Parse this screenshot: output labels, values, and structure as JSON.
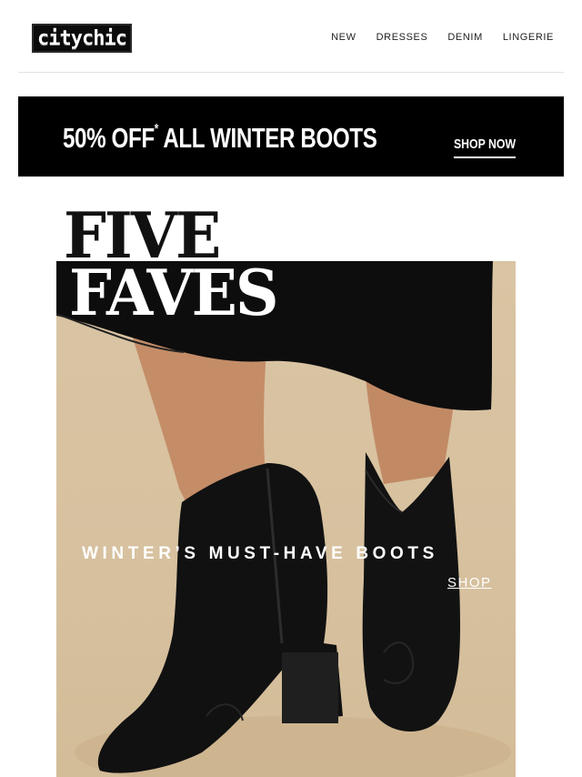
{
  "header": {
    "logo_text": "citychic",
    "nav": [
      "NEW",
      "DRESSES",
      "DENIM",
      "LINGERIE"
    ]
  },
  "banner": {
    "headline": "50% OFF",
    "asterisk": "*",
    "headline_rest": " ALL WINTER BOOTS",
    "cta": "SHOP NOW"
  },
  "hero": {
    "title_line1": "FIVE",
    "title_line2": "FAVES",
    "caption": "WINTER’S MUST-HAVE BOOTS",
    "cta": "SHOP"
  },
  "colors": {
    "banner_bg": "#000000",
    "hero_bg": "#d8c3a2",
    "text_light": "#ffffff"
  }
}
